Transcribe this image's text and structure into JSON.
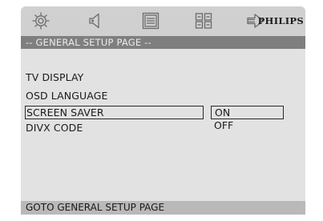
{
  "topbar": {
    "tabs": [
      {
        "icon": "gear-icon"
      },
      {
        "icon": "speaker-icon"
      },
      {
        "icon": "display-icon"
      },
      {
        "icon": "grid-icon"
      },
      {
        "icon": "arrow-right-icon"
      }
    ],
    "brand": "PHILIPS"
  },
  "title": "-- GENERAL SETUP PAGE --",
  "menu": {
    "items": [
      {
        "label": "TV DISPLAY"
      },
      {
        "label": "OSD LANGUAGE"
      },
      {
        "label": "SCREEN SAVER",
        "selected": true
      },
      {
        "label": "DIVX CODE"
      }
    ]
  },
  "options": {
    "items": [
      {
        "label": "ON",
        "selected": true
      },
      {
        "label": "OFF"
      }
    ]
  },
  "footer": {
    "status": "GOTO GENERAL SETUP PAGE"
  },
  "colors": {
    "topbar": "#d0d0d0",
    "title_strip": "#7f7f7f",
    "content": "#e2e2e2",
    "footer": "#b9b9b9"
  }
}
